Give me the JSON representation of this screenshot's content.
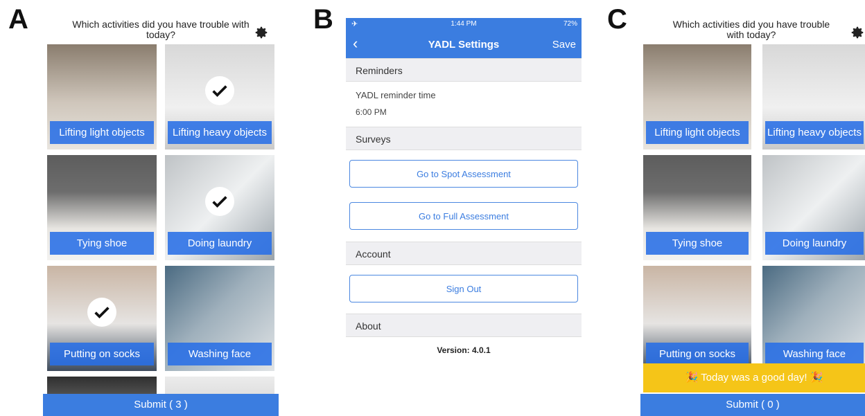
{
  "panels": {
    "a": "A",
    "b": "B",
    "c": "C"
  },
  "colors": {
    "brand_blue": "#3b7de0",
    "banner_yellow": "#f5c518"
  },
  "survey_a": {
    "title": "Which activities did you have trouble with today?",
    "gear_icon": "gear-icon",
    "tiles": [
      {
        "label": "Lifting light objects",
        "selected": false
      },
      {
        "label": "Lifting heavy objects",
        "selected": true
      },
      {
        "label": "Tying shoe",
        "selected": false
      },
      {
        "label": "Doing laundry",
        "selected": true
      },
      {
        "label": "Putting on socks",
        "selected": true
      },
      {
        "label": "Washing face",
        "selected": false
      }
    ],
    "submit_label": "Submit ( 3 )"
  },
  "settings": {
    "status": {
      "time": "1:44 PM",
      "battery": "72%"
    },
    "nav": {
      "title": "YADL Settings",
      "save_label": "Save"
    },
    "reminders_header": "Reminders",
    "reminder_label": "YADL reminder time",
    "reminder_value": "6:00 PM",
    "surveys_header": "Surveys",
    "spot_button": "Go to Spot Assessment",
    "full_button": "Go to Full Assessment",
    "account_header": "Account",
    "signout_button": "Sign Out",
    "about_header": "About",
    "version": "Version: 4.0.1"
  },
  "survey_c": {
    "title": "Which activities did you have trouble with today?",
    "tiles": [
      {
        "label": "Lifting light objects"
      },
      {
        "label": "Lifting heavy objects"
      },
      {
        "label": "Tying shoe"
      },
      {
        "label": "Doing laundry"
      },
      {
        "label": "Putting on socks"
      },
      {
        "label": "Washing face"
      }
    ],
    "banner": "🎉 Today was a good day! 🎉",
    "submit_label": "Submit ( 0 )"
  }
}
